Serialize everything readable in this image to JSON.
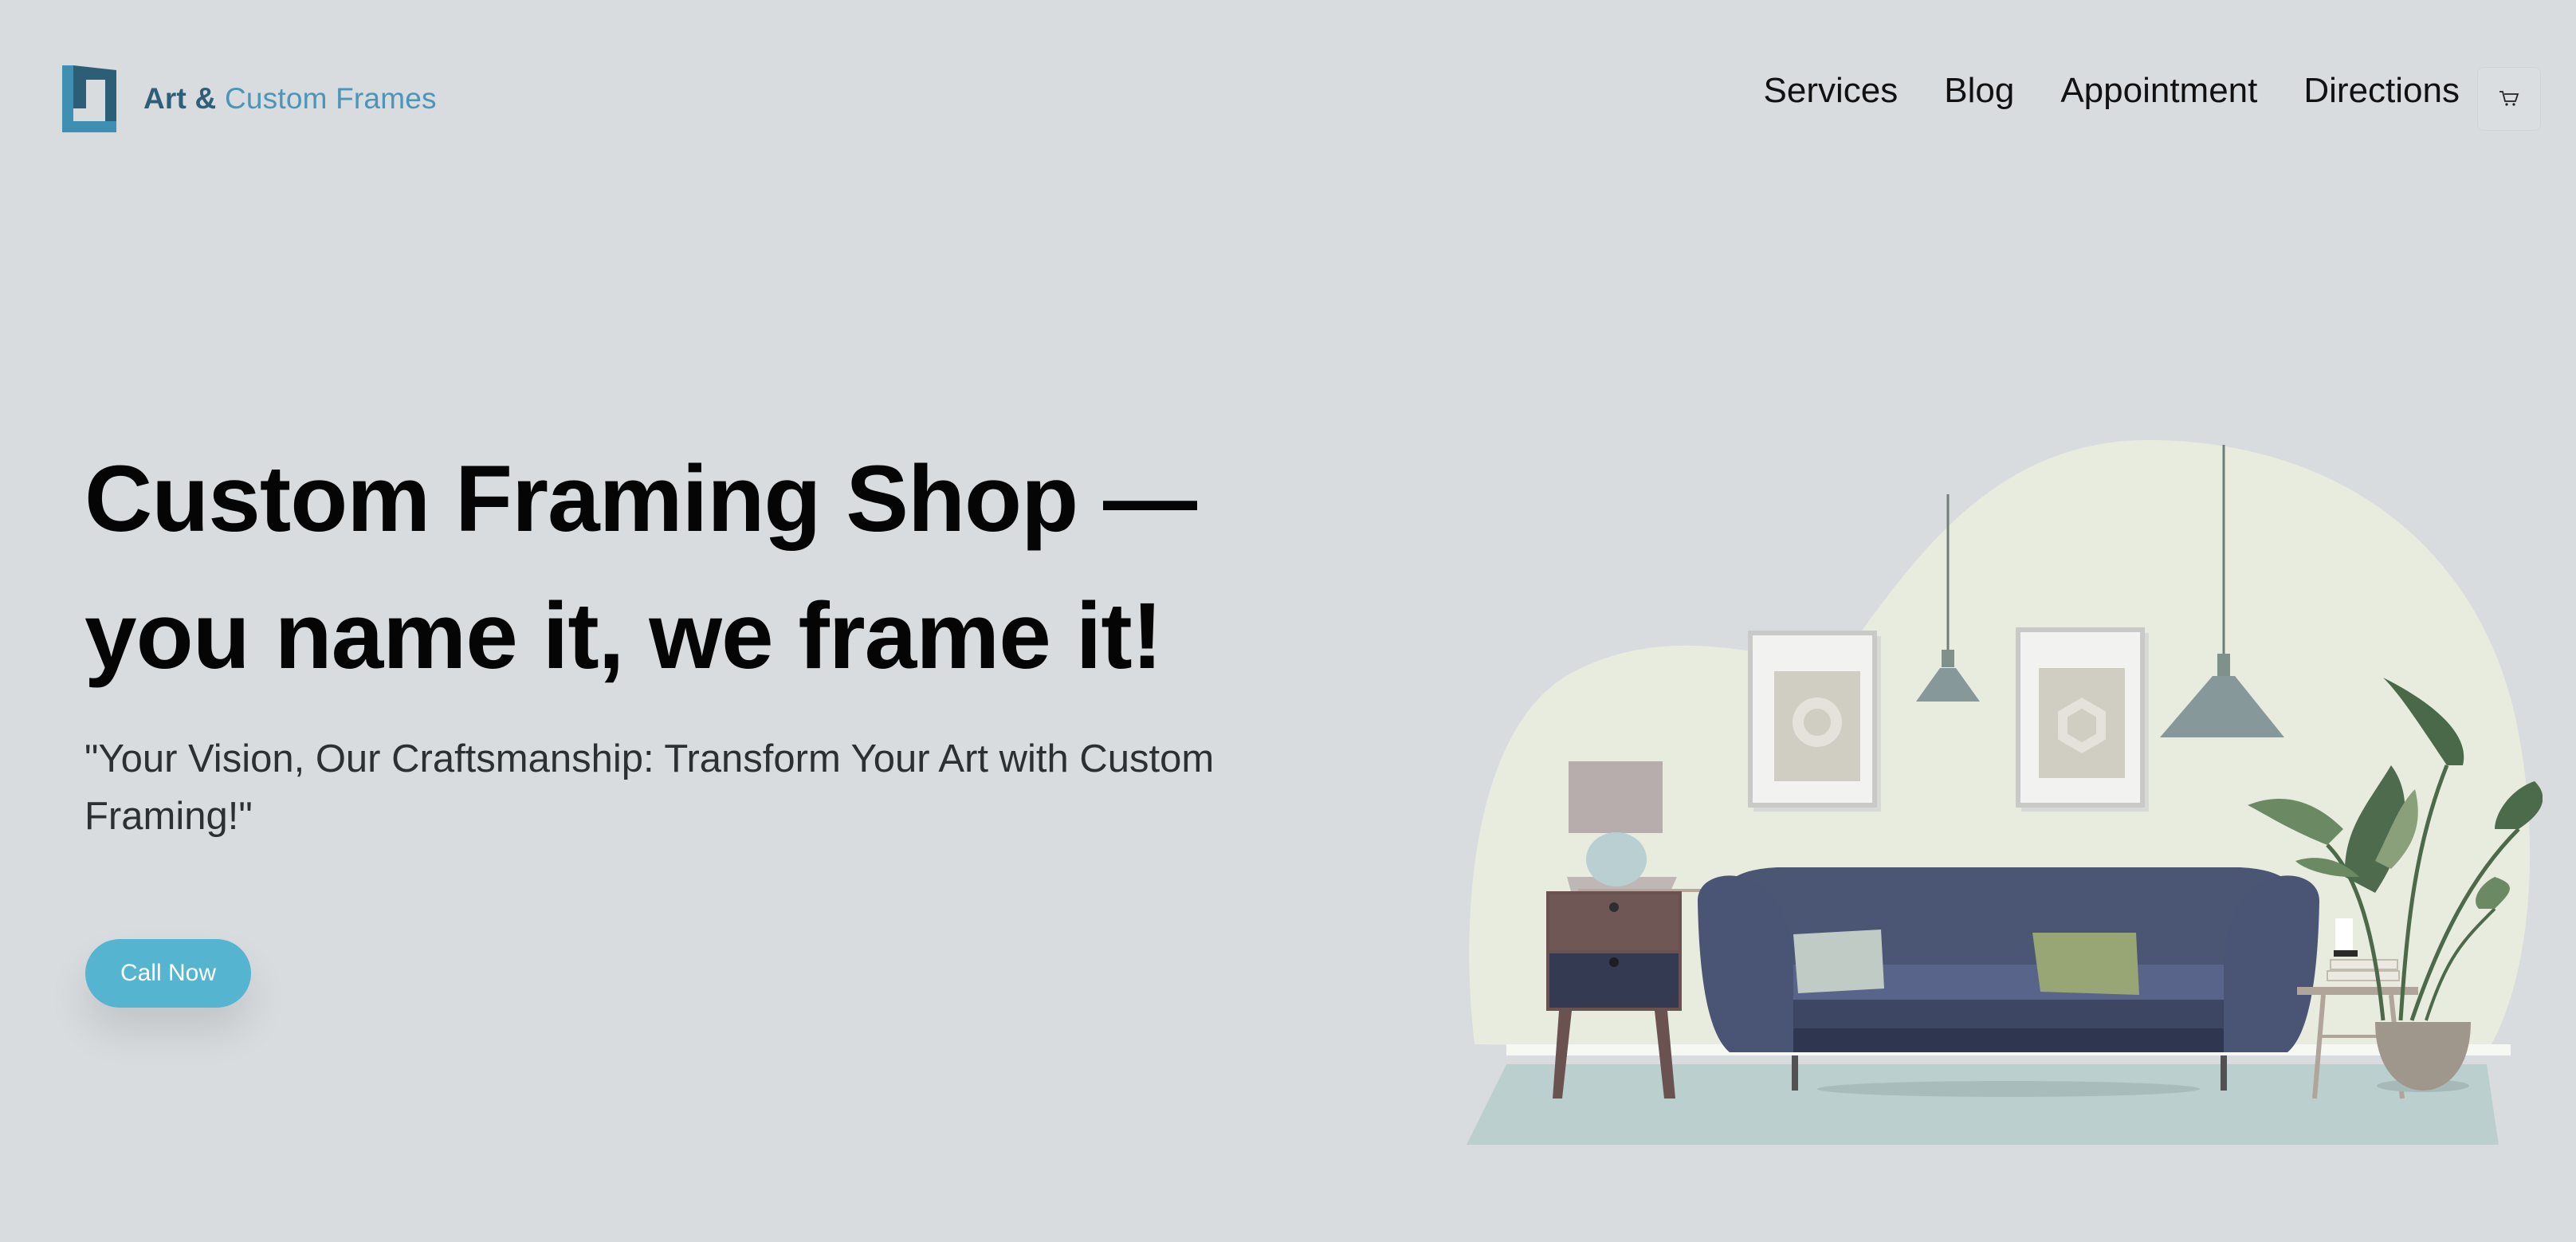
{
  "brand": {
    "name_part1": "Art &",
    "name_part2": "Custom Frames"
  },
  "nav": {
    "items": [
      "Services",
      "Blog",
      "Appointment",
      "Directions"
    ],
    "cart_icon": "cart-icon"
  },
  "hero": {
    "title_line1": "Custom Framing Shop —",
    "title_line2": "you name it, we frame it!",
    "subtitle": "\"Your Vision, Our Craftsmanship: Transform Your Art with Custom Framing!\"",
    "cta_label": "Call Now"
  },
  "colors": {
    "background": "#d8dcdf",
    "accent": "#55b4d0",
    "brand_dark": "#2f5f78",
    "brand_light": "#4b95b8"
  }
}
